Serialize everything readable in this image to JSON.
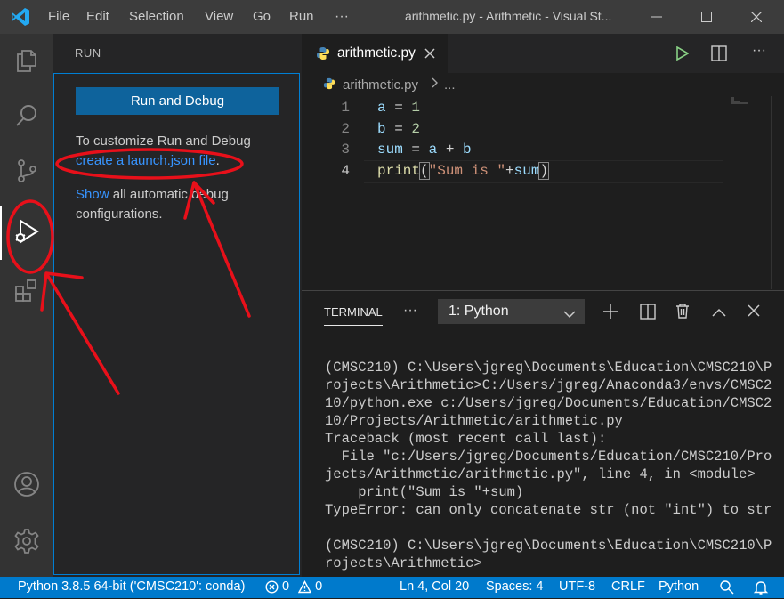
{
  "titlebar": {
    "menu": [
      "File",
      "Edit",
      "Selection",
      "View",
      "Go",
      "Run"
    ],
    "more": "···",
    "title": "arithmetic.py - Arithmetic - Visual St..."
  },
  "sidebar": {
    "title": "RUN",
    "run_button": "Run and Debug",
    "customize_text": "To customize Run and Debug",
    "launch_link": "create a launch.json file",
    "launch_suffix": ".",
    "show_link": "Show",
    "show_text1": " all automatic debug",
    "show_text2": "configurations."
  },
  "editor": {
    "tab_label": "arithmetic.py",
    "breadcrumb_file": "arithmetic.py",
    "breadcrumb_more": "...",
    "lines": [
      {
        "num": "1",
        "text": "a = 1"
      },
      {
        "num": "2",
        "text": "b = 2"
      },
      {
        "num": "3",
        "text": "sum = a + b"
      },
      {
        "num": "4",
        "text": "print(\"Sum is \"+sum)"
      }
    ]
  },
  "panel": {
    "tab": "TERMINAL",
    "more": "···",
    "terminal_select": "1: Python",
    "output": [
      "(CMSC210) C:\\Users\\jgreg\\Documents\\Education\\CMSC210\\P",
      "rojects\\Arithmetic>C:/Users/jgreg/Anaconda3/envs/CMSC2",
      "10/python.exe c:/Users/jgreg/Documents/Education/CMSC2",
      "10/Projects/Arithmetic/arithmetic.py",
      "Traceback (most recent call last):",
      "  File \"c:/Users/jgreg/Documents/Education/CMSC210/Pro",
      "jects/Arithmetic/arithmetic.py\", line 4, in <module>",
      "    print(\"Sum is \"+sum)",
      "TypeError: can only concatenate str (not \"int\") to str",
      "",
      "(CMSC210) C:\\Users\\jgreg\\Documents\\Education\\CMSC210\\P",
      "rojects\\Arithmetic>"
    ]
  },
  "statusbar": {
    "interpreter": "Python 3.8.5 64-bit ('CMSC210': conda)",
    "errors": "0",
    "warnings": "0",
    "position": "Ln 4, Col 20",
    "spaces": "Spaces: 4",
    "encoding": "UTF-8",
    "eol": "CRLF",
    "language": "Python"
  },
  "colors": {
    "accent": "#007acc",
    "button": "#0e639c",
    "link": "#3794ff",
    "annotation": "#e8101a"
  },
  "icons": [
    "vscode-logo-icon",
    "explorer-icon",
    "search-icon",
    "source-control-icon",
    "run-debug-icon",
    "extensions-icon",
    "accounts-icon",
    "manage-gear-icon",
    "python-file-icon",
    "run-file-icon",
    "split-editor-icon",
    "close-icon",
    "add-terminal-icon",
    "trash-icon",
    "chevron-up-icon",
    "bell-icon"
  ]
}
